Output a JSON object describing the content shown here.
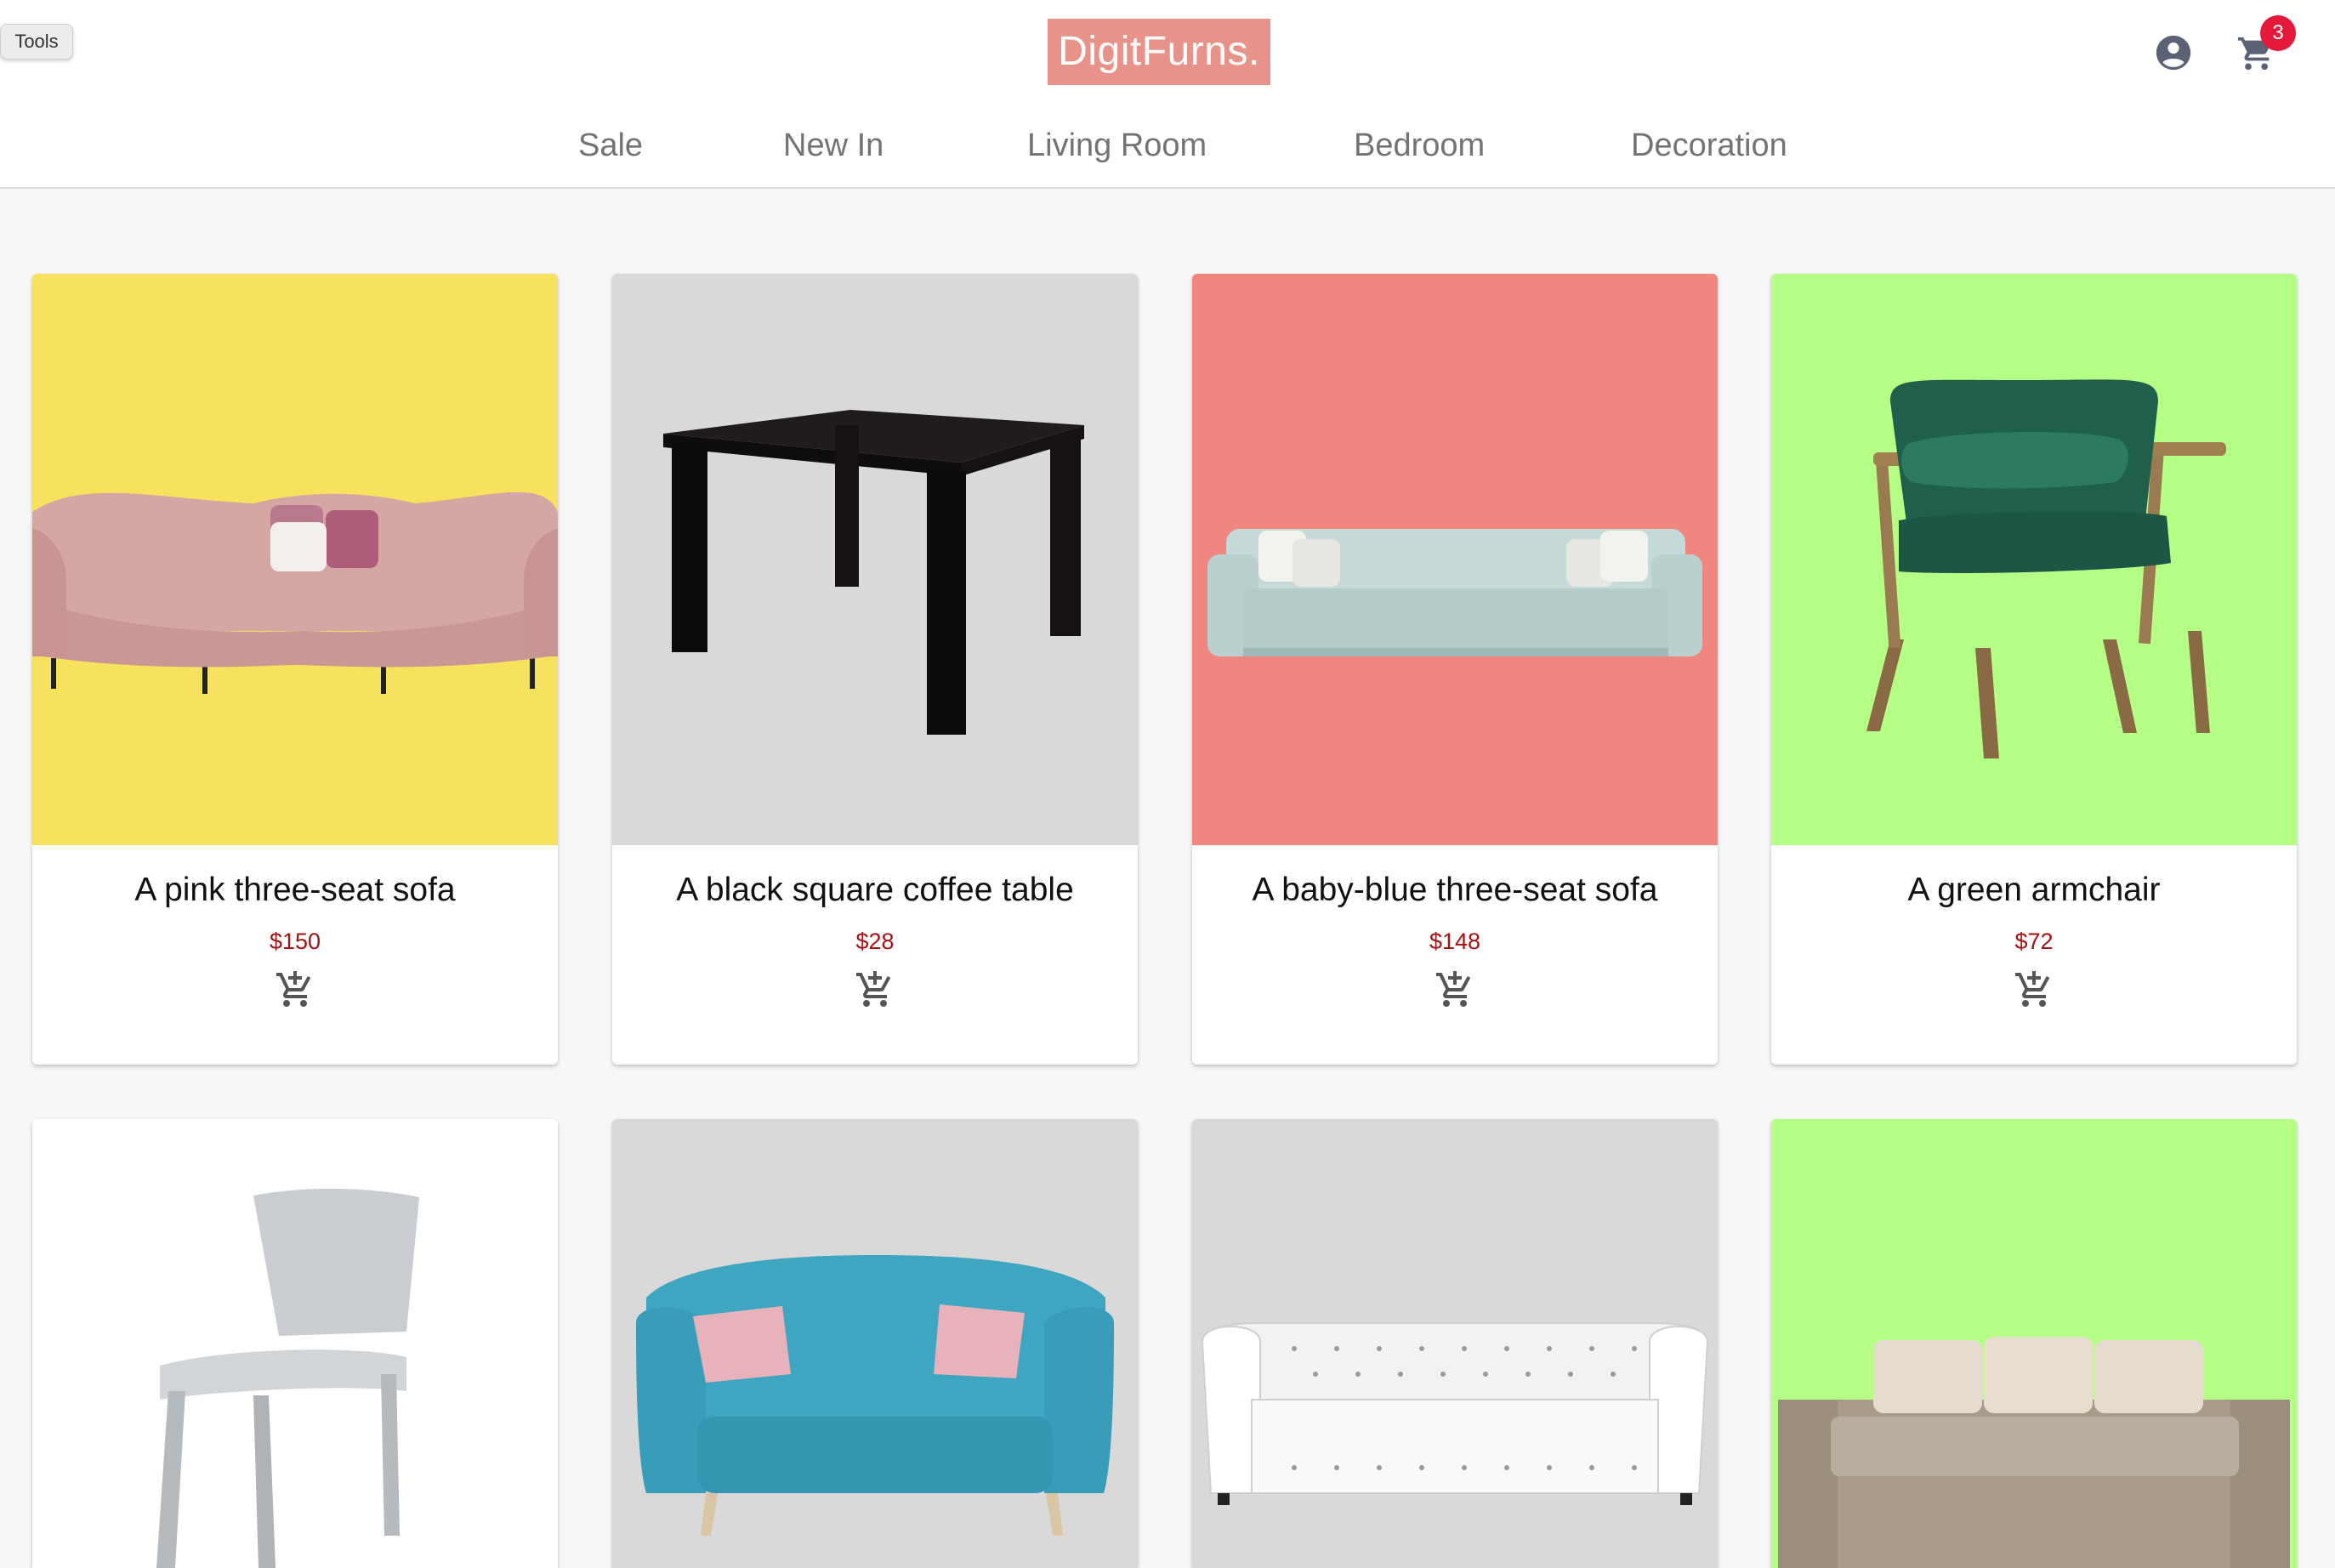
{
  "toolbar": {
    "tools_label": "Tools"
  },
  "header": {
    "logo": "DigitFurns.",
    "cart_count": "3",
    "user_icon": "account-circle-icon",
    "cart_icon": "shopping-cart-icon"
  },
  "nav": {
    "items": [
      {
        "label": "Sale"
      },
      {
        "label": "New In"
      },
      {
        "label": "Living Room"
      },
      {
        "label": "Bedroom"
      },
      {
        "label": "Decoration"
      }
    ]
  },
  "products": [
    {
      "title": "A pink three-seat sofa",
      "price": "$150",
      "bg": "#f7e25e"
    },
    {
      "title": "A black square coffee table",
      "price": "$28",
      "bg": "#d9d9d9"
    },
    {
      "title": "A baby-blue three-seat sofa",
      "price": "$148",
      "bg": "#ef8680"
    },
    {
      "title": "A green armchair",
      "price": "$72",
      "bg": "#b6ff86"
    },
    {
      "bg": "#ffffff"
    },
    {
      "bg": "#d9d9d9"
    },
    {
      "bg": "#d9d9d9"
    },
    {
      "bg": "#b6ff86"
    }
  ],
  "colors": {
    "logo_bg": "#e8938a",
    "price": "#a31313",
    "badge": "#e5193c",
    "nav_text": "#737373"
  }
}
